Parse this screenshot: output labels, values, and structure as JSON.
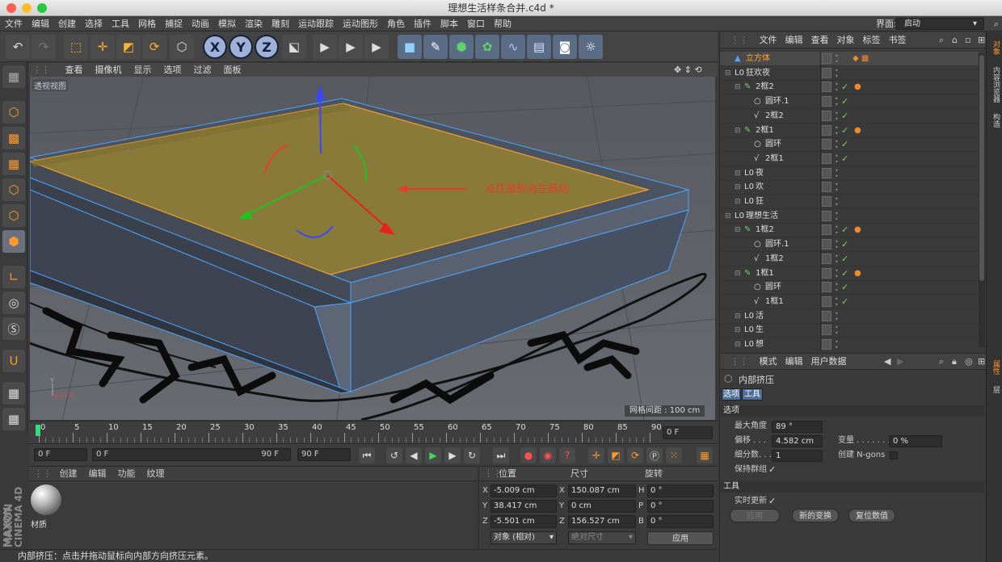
{
  "window": {
    "title": "理想生活样条合并.c4d *"
  },
  "menu": {
    "items": [
      "文件",
      "编辑",
      "创建",
      "选择",
      "工具",
      "网格",
      "捕捉",
      "动画",
      "模拟",
      "渲染",
      "雕刻",
      "运动跟踪",
      "运动图形",
      "角色",
      "插件",
      "脚本",
      "窗口",
      "帮助"
    ],
    "layout_label": "界面:",
    "layout_value": "启动"
  },
  "toolbar": {
    "axis_x": "X",
    "axis_y": "Y",
    "axis_z": "Z"
  },
  "viewport": {
    "menu": [
      "查看",
      "摄像机",
      "显示",
      "选项",
      "过滤",
      "面板"
    ],
    "label": "透视视图",
    "annotation": "点住鼠标向左移动",
    "grid_info": "网格间距 : 100 cm",
    "axis_x": "X",
    "axis_y": "Y",
    "plate_color": "#8a7a3a",
    "accent_color": "#e83a2a"
  },
  "timeline": {
    "ticks": [
      "0",
      "5",
      "10",
      "15",
      "20",
      "25",
      "30",
      "35",
      "40",
      "45",
      "50",
      "55",
      "60",
      "65",
      "70",
      "75",
      "80",
      "85",
      "90"
    ],
    "end_field": "0 F"
  },
  "playback": {
    "start": "0 F",
    "range_start": "0 F",
    "range_end": "90 F",
    "end": "90 F"
  },
  "material": {
    "menu": [
      "创建",
      "编辑",
      "功能",
      "纹理"
    ],
    "name": "材质"
  },
  "coords": {
    "headers": [
      "位置",
      "尺寸",
      "旋转"
    ],
    "pos": [
      {
        "axis": "X",
        "value": "-5.009 cm"
      },
      {
        "axis": "Y",
        "value": "38.417 cm"
      },
      {
        "axis": "Z",
        "value": "-5.501 cm"
      }
    ],
    "size": [
      {
        "axis": "X",
        "value": "150.087 cm"
      },
      {
        "axis": "Y",
        "value": "0 cm"
      },
      {
        "axis": "Z",
        "value": "156.527 cm"
      }
    ],
    "rot": [
      {
        "axis": "H",
        "value": "0 °"
      },
      {
        "axis": "P",
        "value": "0 °"
      },
      {
        "axis": "B",
        "value": "0 °"
      }
    ],
    "mode": "对象 (相对)",
    "size_mode": "绝对尺寸",
    "apply": "应用"
  },
  "status": {
    "text": "内部挤压：点击并拖动鼠标向内部方向挤压元素。"
  },
  "objects": {
    "menu": [
      "文件",
      "编辑",
      "查看",
      "对象",
      "标签",
      "书签"
    ],
    "rows": [
      {
        "name": "立方体",
        "indent": 0,
        "icon": "▲",
        "highlight": true,
        "check": false,
        "tag": "◆ ▦"
      },
      {
        "name": "狂欢夜",
        "indent": 0,
        "icon": "L0",
        "highlight": false,
        "check": false,
        "tag": ""
      },
      {
        "name": "2框2",
        "indent": 1,
        "icon": "✎",
        "highlight": false,
        "check": true,
        "tag": "●"
      },
      {
        "name": "圆环.1",
        "indent": 2,
        "icon": "○",
        "highlight": false,
        "check": true,
        "tag": ""
      },
      {
        "name": "2框2",
        "indent": 2,
        "icon": "√",
        "highlight": false,
        "check": true,
        "tag": ""
      },
      {
        "name": "2框1",
        "indent": 1,
        "icon": "✎",
        "highlight": false,
        "check": true,
        "tag": "●"
      },
      {
        "name": "圆环",
        "indent": 2,
        "icon": "○",
        "highlight": false,
        "check": true,
        "tag": ""
      },
      {
        "name": "2框1",
        "indent": 2,
        "icon": "√",
        "highlight": false,
        "check": true,
        "tag": ""
      },
      {
        "name": "夜",
        "indent": 1,
        "icon": "L0",
        "highlight": false,
        "check": false,
        "tag": ""
      },
      {
        "name": "欢",
        "indent": 1,
        "icon": "L0",
        "highlight": false,
        "check": false,
        "tag": ""
      },
      {
        "name": "狂",
        "indent": 1,
        "icon": "L0",
        "highlight": false,
        "check": false,
        "tag": ""
      },
      {
        "name": "理想生活",
        "indent": 0,
        "icon": "L0",
        "highlight": false,
        "check": false,
        "tag": ""
      },
      {
        "name": "1框2",
        "indent": 1,
        "icon": "✎",
        "highlight": false,
        "check": true,
        "tag": "●"
      },
      {
        "name": "圆环.1",
        "indent": 2,
        "icon": "○",
        "highlight": false,
        "check": true,
        "tag": ""
      },
      {
        "name": "1框2",
        "indent": 2,
        "icon": "√",
        "highlight": false,
        "check": true,
        "tag": ""
      },
      {
        "name": "1框1",
        "indent": 1,
        "icon": "✎",
        "highlight": false,
        "check": true,
        "tag": "●"
      },
      {
        "name": "圆环",
        "indent": 2,
        "icon": "○",
        "highlight": false,
        "check": true,
        "tag": ""
      },
      {
        "name": "1框1",
        "indent": 2,
        "icon": "√",
        "highlight": false,
        "check": true,
        "tag": ""
      },
      {
        "name": "活",
        "indent": 1,
        "icon": "L0",
        "highlight": false,
        "check": false,
        "tag": ""
      },
      {
        "name": "生",
        "indent": 1,
        "icon": "L0",
        "highlight": false,
        "check": false,
        "tag": ""
      },
      {
        "name": "想",
        "indent": 1,
        "icon": "L0",
        "highlight": false,
        "check": false,
        "tag": ""
      }
    ]
  },
  "attributes": {
    "menu": [
      "模式",
      "编辑",
      "用户数据"
    ],
    "tool_title": "内部挤压",
    "tabs": [
      "选项",
      "工具"
    ],
    "section_options": "选项",
    "max_angle_label": "最大角度",
    "max_angle": "89 °",
    "offset_label": "偏移 . . .",
    "offset": "4.582 cm",
    "variance_label": "变量 . . . . . . .",
    "variance": "0 %",
    "subdiv_label": "细分数. . .",
    "subdiv": "1",
    "ngons_label": "创建 N-gons",
    "keep_groups_label": "保持群组",
    "section_tool": "工具",
    "realtime_label": "实时更新",
    "apply": "应用",
    "new_transform": "新的变换",
    "reset": "复位数值"
  },
  "side_tabs": {
    "top": [
      "对象",
      "内容浏览器",
      "构造"
    ],
    "bottom": [
      "属性",
      "层"
    ]
  }
}
